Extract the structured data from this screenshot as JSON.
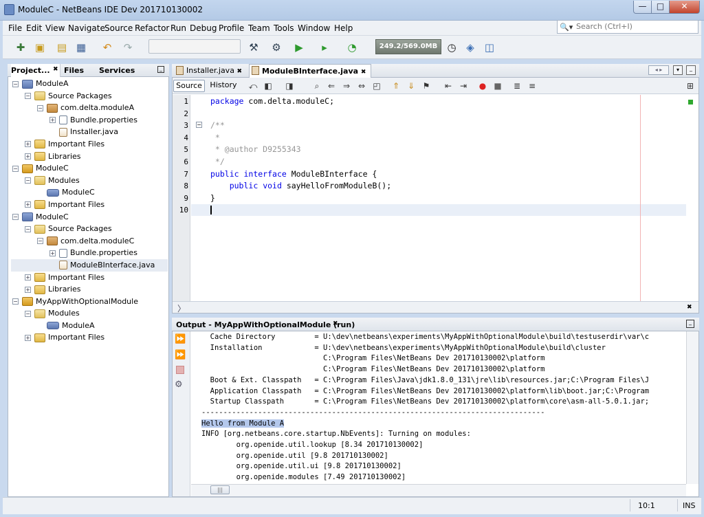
{
  "window": {
    "title": "ModuleC - NetBeans IDE Dev 201710130002",
    "minimize": "—",
    "maximize": "□",
    "close": "✕"
  },
  "menu": [
    "File",
    "Edit",
    "View",
    "Navigate",
    "Source",
    "Refactor",
    "Run",
    "Debug",
    "Profile",
    "Team",
    "Tools",
    "Window",
    "Help"
  ],
  "search": {
    "placeholder": "Search (Ctrl+I)"
  },
  "toolbar": {
    "memory": "249.2/569.0MB"
  },
  "projects_panel": {
    "tabs": [
      "Project...",
      "Files",
      "Services"
    ],
    "tree": [
      {
        "label": "ModuleA",
        "icon": "project-module-icon",
        "level": 0,
        "exp": "−"
      },
      {
        "label": "Source Packages",
        "icon": "source-packages-icon",
        "level": 1,
        "exp": "−"
      },
      {
        "label": "com.delta.moduleA",
        "icon": "package-icon",
        "level": 2,
        "exp": "−"
      },
      {
        "label": "Bundle.properties",
        "icon": "properties-file-icon",
        "level": 3,
        "exp": "+"
      },
      {
        "label": "Installer.java",
        "icon": "java-file-icon",
        "level": 3,
        "exp": ""
      },
      {
        "label": "Important Files",
        "icon": "folder-icon",
        "level": 1,
        "exp": "+"
      },
      {
        "label": "Libraries",
        "icon": "libraries-icon",
        "level": 1,
        "exp": "+"
      },
      {
        "label": "ModuleC",
        "icon": "module-suite-icon",
        "level": 0,
        "exp": "−"
      },
      {
        "label": "Modules",
        "icon": "modules-folder-icon",
        "level": 1,
        "exp": "−"
      },
      {
        "label": "ModuleC",
        "icon": "module-icon",
        "level": 2,
        "exp": ""
      },
      {
        "label": "Important Files",
        "icon": "folder-icon",
        "level": 1,
        "exp": "+"
      },
      {
        "label": "ModuleC",
        "icon": "project-module-icon",
        "level": 0,
        "exp": "−"
      },
      {
        "label": "Source Packages",
        "icon": "source-packages-icon",
        "level": 1,
        "exp": "−"
      },
      {
        "label": "com.delta.moduleC",
        "icon": "package-icon",
        "level": 2,
        "exp": "−"
      },
      {
        "label": "Bundle.properties",
        "icon": "properties-file-icon",
        "level": 3,
        "exp": "+"
      },
      {
        "label": "ModuleBInterface.java",
        "icon": "java-file-icon",
        "level": 3,
        "exp": "",
        "selected": true
      },
      {
        "label": "Important Files",
        "icon": "folder-icon",
        "level": 1,
        "exp": "+"
      },
      {
        "label": "Libraries",
        "icon": "libraries-icon",
        "level": 1,
        "exp": "+"
      },
      {
        "label": "MyAppWithOptionalModule",
        "icon": "module-suite-icon",
        "level": 0,
        "exp": "−"
      },
      {
        "label": "Modules",
        "icon": "modules-folder-icon",
        "level": 1,
        "exp": "−"
      },
      {
        "label": "ModuleA",
        "icon": "module-icon",
        "level": 2,
        "exp": ""
      },
      {
        "label": "Important Files",
        "icon": "folder-icon",
        "level": 1,
        "exp": "+"
      }
    ]
  },
  "editor": {
    "tabs": [
      {
        "label": "Installer.java",
        "active": false
      },
      {
        "label": "ModuleBInterface.java",
        "active": true
      }
    ],
    "source_label": "Source",
    "history_label": "History",
    "line_numbers": [
      "1",
      "2",
      "3",
      "4",
      "5",
      "6",
      "7",
      "8",
      "9",
      "10"
    ],
    "code": [
      [
        {
          "t": "package",
          "c": "kw"
        },
        {
          "t": " com.delta.moduleC;",
          "c": ""
        }
      ],
      [],
      [
        {
          "t": "/**",
          "c": "cm"
        }
      ],
      [
        {
          "t": " *",
          "c": "cm"
        }
      ],
      [
        {
          "t": " * @author D9255343",
          "c": "cm"
        }
      ],
      [
        {
          "t": " */",
          "c": "cm"
        }
      ],
      [
        {
          "t": "public",
          "c": "kw"
        },
        {
          "t": " ",
          "c": ""
        },
        {
          "t": "interface",
          "c": "kw"
        },
        {
          "t": " ModuleBInterface {",
          "c": ""
        }
      ],
      [
        {
          "t": "    ",
          "c": ""
        },
        {
          "t": "public",
          "c": "kw"
        },
        {
          "t": " ",
          "c": ""
        },
        {
          "t": "void",
          "c": "kw"
        },
        {
          "t": " sayHelloFromModuleB();",
          "c": ""
        }
      ],
      [
        {
          "t": "}",
          "c": ""
        }
      ],
      []
    ]
  },
  "output": {
    "title": "Output - MyAppWithOptionalModule (run)",
    "lines": [
      "  Cache Directory         = U:\\dev\\netbeans\\experiments\\MyAppWithOptionalModule\\build\\testuserdir\\var\\c",
      "  Installation            = U:\\dev\\netbeans\\experiments\\MyAppWithOptionalModule\\build\\cluster",
      "                            C:\\Program Files\\NetBeans Dev 201710130002\\platform",
      "                            C:\\Program Files\\NetBeans Dev 201710130002\\platform",
      "  Boot & Ext. Classpath   = C:\\Program Files\\Java\\jdk1.8.0_131\\jre\\lib\\resources.jar;C:\\Program Files\\J",
      "  Application Classpath   = C:\\Program Files\\NetBeans Dev 201710130002\\platform\\lib\\boot.jar;C:\\Program",
      "  Startup Classpath       = C:\\Program Files\\NetBeans Dev 201710130002\\platform\\core\\asm-all-5.0.1.jar;",
      "-------------------------------------------------------------------------------",
      "Hello from Module A",
      "INFO [org.netbeans.core.startup.NbEvents]: Turning on modules:",
      "        org.openide.util.lookup [8.34 201710130002]",
      "        org.openide.util [9.8 201710130002]",
      "        org.openide.util.ui [9.8 201710130002]",
      "        org.openide.modules [7.49 201710130002]"
    ],
    "highlight_line": 8
  },
  "status": {
    "position": "10:1",
    "mode": "INS"
  }
}
